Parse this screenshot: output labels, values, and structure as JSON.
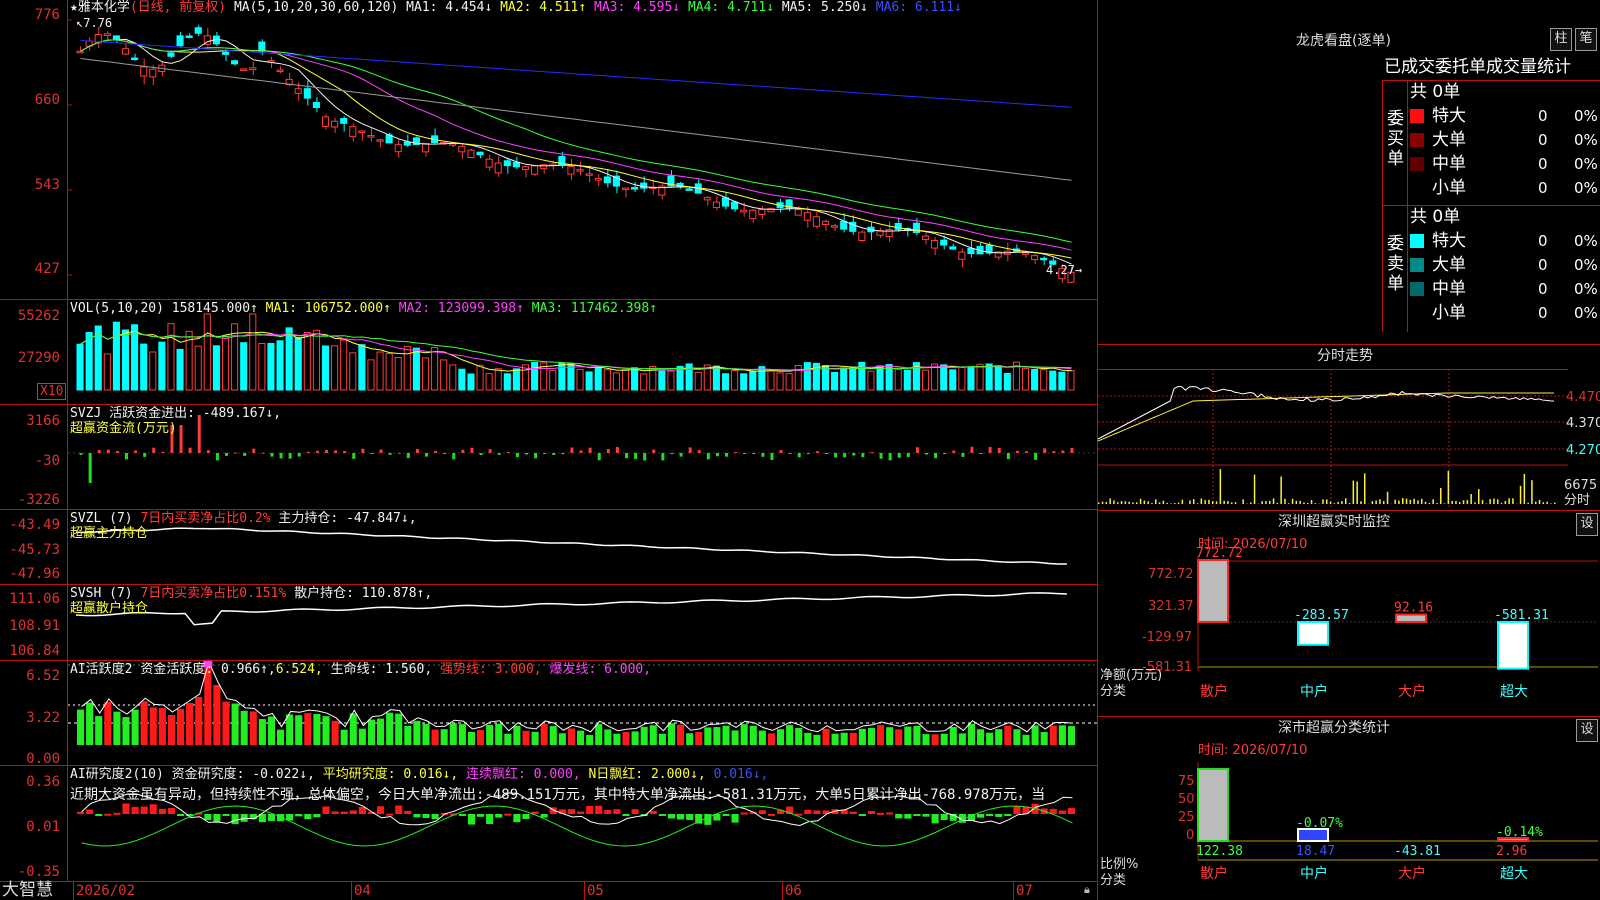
{
  "colors": {
    "up": "#ff3b3b",
    "down": "#00ffff",
    "grid": "#b11",
    "ma1": "#f2f2f2",
    "ma2": "#ffff3a",
    "ma3": "#ff40ff",
    "ma4": "#3aff3a",
    "ma5": "#9a9a9a",
    "ma6": "#2a2aff"
  },
  "kline": {
    "stock_name": "★雅本化学",
    "mode": "(日线, 前复权)",
    "ma_params": "MA(5,10,20,30,60,120)",
    "ma1": "MA1: 4.454↓",
    "ma2": "MA2: 4.511↑",
    "ma3": "MA3: 4.595↓",
    "ma4": "MA4: 4.711↓",
    "ma5": "MA5: 5.250↓",
    "ma6": "MA6: 6.111↓",
    "high_mark": "7.76",
    "low_mark": "4.27→",
    "axis": [
      "776",
      "660",
      "543",
      "427"
    ]
  },
  "vol": {
    "title": "VOL(5,10,20)",
    "value": "158145.000↑",
    "ma1": "MA1: 106752.000↑",
    "ma2": "MA2: 123099.398↑",
    "ma3": "MA3: 117462.398↑",
    "axis": [
      "55262",
      "27290"
    ],
    "unit": "X10"
  },
  "svzj": {
    "name": "SVZJ",
    "label": "活跃资金进出: -489.167↓,",
    "subtitle": "超赢资金流(万元)",
    "axis": [
      "3166",
      "-30",
      "-3226"
    ]
  },
  "svzl": {
    "name": "SVZL (7)",
    "ratio": "7日内买卖净占比0.2%",
    "hold": "主力持仓: -47.847↓,",
    "subtitle": "超赢主力持仓",
    "axis": [
      "-43.49",
      "-45.73",
      "-47.96"
    ]
  },
  "svsh": {
    "name": "SVSH (7)",
    "ratio": "7日内买卖净占比0.151%",
    "hold": "散户持仓: 110.878↑,",
    "subtitle": "超赢散户持仓",
    "axis": [
      "111.06",
      "108.91",
      "106.84"
    ]
  },
  "ai_active": {
    "name": "AI活跃度2",
    "v1": "资金活跃度: 0.966↑,",
    "v2": "6.524,",
    "v3": "生命线: 1.560,",
    "v4": "强势线: 3.000,",
    "v5": "爆发线: 6.000,",
    "axis": [
      "6.52",
      "3.22",
      "0.00"
    ]
  },
  "ai_research": {
    "name": "AI研究度2(10)",
    "v1": "资金研究度: -0.022↓,",
    "v2": "平均研究度: 0.016↓,",
    "v3": "连续飘红: 0.000,",
    "v4": "N日飘红: 2.000↓,",
    "v5": "0.016↓,",
    "commentary": "近期大资金虽有异动，但持续性不强，总体偏空，今日大单净流出:-489.151万元，其中特大单净流出:-581.31万元，大单5日累计净出-768.978万元，当",
    "axis": [
      "0.36",
      "0.01",
      "-0.35"
    ]
  },
  "date_axis": [
    "2026/02",
    "04",
    "05",
    "06",
    "07"
  ],
  "footer": {
    "brand": "大智慧"
  },
  "dragon_tiger": {
    "title": "龙虎看盘(逐单)",
    "btn1": "柱",
    "btn2": "笔",
    "header": "已成交委托单成交量统计",
    "buy": {
      "label": "委买单",
      "total": "共 0单",
      "rows": [
        {
          "name": "特大",
          "count": "0",
          "pct": "0%",
          "color": "#ff1010"
        },
        {
          "name": "大单",
          "count": "0",
          "pct": "0%",
          "color": "#8a0000"
        },
        {
          "name": "中单",
          "count": "0",
          "pct": "0%",
          "color": "#600000"
        },
        {
          "name": "小单",
          "count": "0",
          "pct": "0%",
          "color": "#000000"
        }
      ]
    },
    "sell": {
      "label": "委卖单",
      "total": "共 0单",
      "rows": [
        {
          "name": "特大",
          "count": "0",
          "pct": "0%",
          "color": "#00ffff"
        },
        {
          "name": "大单",
          "count": "0",
          "pct": "0%",
          "color": "#008b8b"
        },
        {
          "name": "中单",
          "count": "0",
          "pct": "0%",
          "color": "#006a6a"
        },
        {
          "name": "小单",
          "count": "0",
          "pct": "0%",
          "color": "#000000"
        }
      ]
    }
  },
  "intraday": {
    "title": "分时走势",
    "axis": [
      "4.470",
      "4.370",
      "4.270"
    ],
    "vol_axis": "6675",
    "vol_label": "分时"
  },
  "sz_monitor": {
    "title": "深圳超赢实时监控",
    "btn": "设",
    "time": "时间: 2026/07/10",
    "axis": [
      "772.72",
      "321.37",
      "-129.97",
      "-581.31"
    ],
    "ylabel": "净额(万元)",
    "xlabel": "分类",
    "cats": [
      "散户",
      "中户",
      "大户",
      "超大"
    ],
    "values": [
      772.72,
      -283.57,
      92.16,
      -581.31
    ],
    "labels": [
      "772.72",
      "-283.57",
      "92.16",
      "-581.31"
    ]
  },
  "sz_class": {
    "title": "深市超赢分类统计",
    "btn": "设",
    "time": "时间: 2026/07/10",
    "axis": [
      "75",
      "50",
      "25",
      "0"
    ],
    "ylabel": "比例%",
    "xlabel": "分类",
    "cats": [
      "散户",
      "中户",
      "大户",
      "超大"
    ],
    "values": [
      122.38,
      18.47,
      -43.81,
      2.96
    ],
    "pct": [
      null,
      -0.07,
      null,
      -0.14
    ],
    "pct_labels": [
      "",
      "-0.07%",
      "",
      "-0.14%"
    ],
    "val_labels": [
      "122.38",
      "18.47",
      "-43.81",
      "2.96"
    ]
  }
}
